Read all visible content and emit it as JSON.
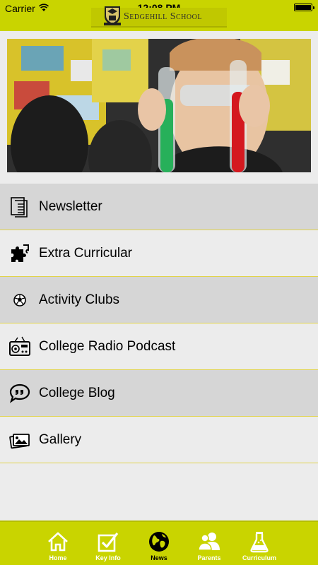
{
  "status_bar": {
    "carrier": "Carrier",
    "time": "12:08 PM",
    "battery_level": 1.0
  },
  "header": {
    "school_name": "Sedgehill School",
    "crest_icon": "school-crest-icon"
  },
  "hero": {
    "image": "student-with-test-tubes-photo"
  },
  "menu": {
    "items": [
      {
        "label": "Newsletter",
        "icon": "document-icon"
      },
      {
        "label": "Extra Curricular",
        "icon": "puzzle-icon"
      },
      {
        "label": "Activity Clubs",
        "icon": "football-icon"
      },
      {
        "label": "College Radio Podcast",
        "icon": "radio-icon"
      },
      {
        "label": "College Blog",
        "icon": "speech-bubble-icon"
      },
      {
        "label": "Gallery",
        "icon": "photos-icon"
      }
    ]
  },
  "tabbar": {
    "tabs": [
      {
        "label": "Home",
        "icon": "home-icon",
        "active": false
      },
      {
        "label": "Key Info",
        "icon": "checkbox-icon",
        "active": false
      },
      {
        "label": "News",
        "icon": "globe-icon",
        "active": true
      },
      {
        "label": "Parents",
        "icon": "people-icon",
        "active": false
      },
      {
        "label": "Curriculum",
        "icon": "flask-icon",
        "active": false
      }
    ]
  },
  "colors": {
    "accent": "#c9d400",
    "row_dark": "#d6d6d6",
    "row_light": "#ececec",
    "divider": "#e1d34a"
  }
}
